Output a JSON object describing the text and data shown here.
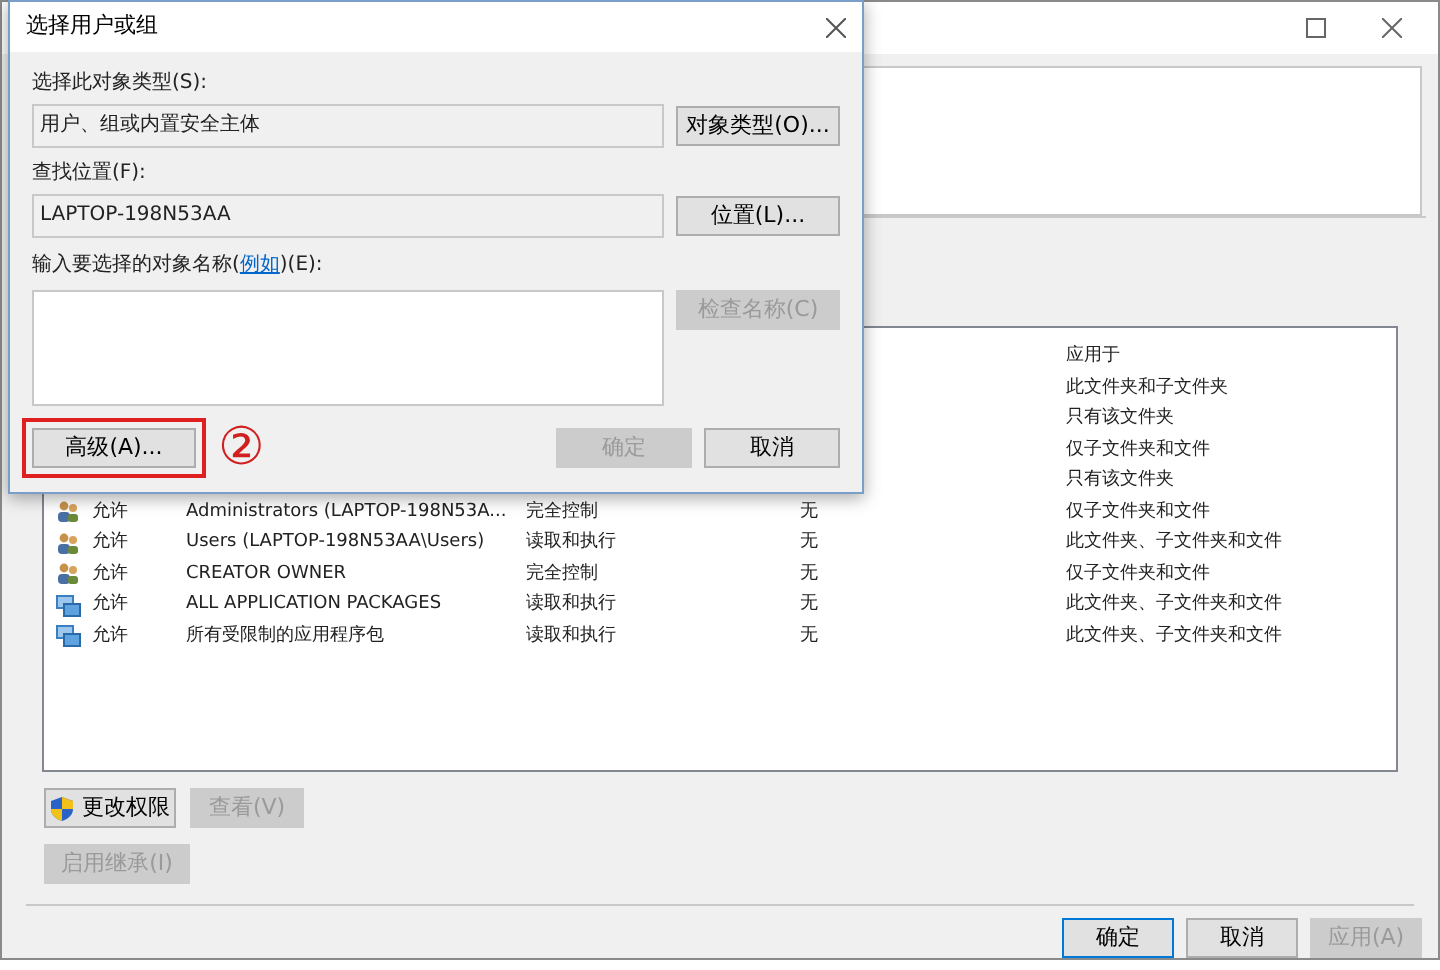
{
  "back_window": {
    "controls": [
      {
        "kind": "maximize"
      },
      {
        "kind": "close"
      }
    ],
    "list": {
      "header": {
        "applies_to": "应用于"
      },
      "rows": [
        {
          "applies_to": "此文件夹和子文件夹"
        },
        {
          "applies_to": "只有该文件夹"
        },
        {
          "applies_to": "仅子文件夹和文件"
        },
        {
          "applies_to": "只有该文件夹"
        },
        {
          "kind": "users",
          "type": "允许",
          "principal": "Administrators (LAPTOP-198N53A...",
          "access": "完全控制",
          "inherited": "无",
          "applies_to": "仅子文件夹和文件"
        },
        {
          "kind": "users",
          "type": "允许",
          "principal": "Users (LAPTOP-198N53AA\\Users)",
          "access": "读取和执行",
          "inherited": "无",
          "applies_to": "此文件夹、子文件夹和文件"
        },
        {
          "kind": "users",
          "type": "允许",
          "principal": "CREATOR OWNER",
          "access": "完全控制",
          "inherited": "无",
          "applies_to": "仅子文件夹和文件"
        },
        {
          "kind": "packages",
          "type": "允许",
          "principal": "ALL APPLICATION PACKAGES",
          "access": "读取和执行",
          "inherited": "无",
          "applies_to": "此文件夹、子文件夹和文件"
        },
        {
          "kind": "packages",
          "type": "允许",
          "principal": "所有受限制的应用程序包",
          "access": "读取和执行",
          "inherited": "无",
          "applies_to": "此文件夹、子文件夹和文件"
        }
      ]
    },
    "buttons": [
      {
        "kind": "shield",
        "label": "更改权限",
        "disabled": false
      },
      {
        "kind": "plain",
        "label": "查看(V)",
        "disabled": true
      }
    ],
    "inherit_button": {
      "label": "启用继承(I)",
      "disabled": true
    },
    "footer_buttons": [
      {
        "label": "确定",
        "disabled": false,
        "focused": true
      },
      {
        "label": "取消",
        "disabled": false,
        "focused": false
      },
      {
        "label": "应用(A)",
        "disabled": true,
        "focused": false
      }
    ]
  },
  "dialog": {
    "title": "选择用户或组",
    "object_type": {
      "label": "选择此对象类型(S):",
      "value": "用户、组或内置安全主体",
      "button": "对象类型(O)..."
    },
    "location": {
      "label": "查找位置(F):",
      "value": "LAPTOP-198N53AA",
      "button": "位置(L)..."
    },
    "names": {
      "label_before": "输入要选择的对象名称(",
      "link": "例如",
      "label_after": ")(E):",
      "check_button": {
        "label": "检查名称(C)",
        "disabled": true
      }
    },
    "advanced_button": {
      "label": "高级(A)...",
      "highlighted": true
    },
    "annotation": "②",
    "ok_button": {
      "label": "确定",
      "disabled": true
    },
    "cancel_button": {
      "label": "取消",
      "disabled": false
    }
  }
}
